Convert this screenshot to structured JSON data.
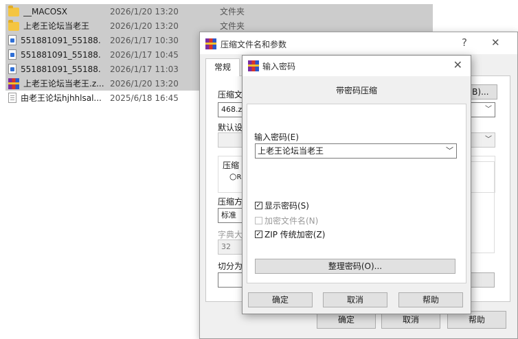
{
  "explorer": {
    "files": [
      {
        "name": "__MACOSX",
        "date": "2026/1/20 13:20",
        "type": "文件夹",
        "icon": "folder-icon",
        "selected": true
      },
      {
        "name": "上老王论坛当老王",
        "date": "2026/1/20 13:20",
        "type": "文件夹",
        "icon": "folder-icon",
        "selected": true
      },
      {
        "name": "551881091_55188...",
        "date": "2026/1/17 10:30",
        "type": "",
        "icon": "document-icon",
        "selected": true
      },
      {
        "name": "551881091_55188...",
        "date": "2026/1/17 10:45",
        "type": "",
        "icon": "document-icon",
        "selected": true
      },
      {
        "name": "551881091_55188...",
        "date": "2026/1/17 11:03",
        "type": "",
        "icon": "document-icon",
        "selected": true
      },
      {
        "name": "上老王论坛当老王.z...",
        "date": "2026/1/20 13:20",
        "type": "",
        "icon": "winrar-archive-icon",
        "selected": true
      },
      {
        "name": "由老王论坛hjhhlsal...",
        "date": "2025/6/18 16:45",
        "type": "",
        "icon": "text-file-icon",
        "selected": false
      }
    ]
  },
  "main_dialog": {
    "title": "压缩文件名和参数",
    "help_glyph": "?",
    "close_glyph": "✕",
    "tab_general": "常规",
    "archive_name_label": "压缩文",
    "browse_button": "(B)...",
    "archive_name_value": "468.zip",
    "default_profile_label": "默认设",
    "format_group_label": "压缩",
    "radio_partial": "R",
    "method_label": "压缩方",
    "method_value": "标准",
    "dict_label": "字典大",
    "dict_value": "32",
    "split_label": "切分为",
    "ok": "确定",
    "cancel": "取消",
    "help": "帮助"
  },
  "password_dialog": {
    "title": "输入密码",
    "close_glyph": "✕",
    "heading": "带密码压缩",
    "enter_label": "输入密码(E)",
    "password_value": "上老王论坛当老王",
    "show_password": {
      "label": "显示密码(S)",
      "checked": true,
      "enabled": true
    },
    "encrypt_names": {
      "label": "加密文件名(N)",
      "checked": false,
      "enabled": false
    },
    "zip_legacy": {
      "label": "ZIP 传统加密(Z)",
      "checked": true,
      "enabled": true
    },
    "organize_button": "整理密码(O)...",
    "ok": "确定",
    "cancel": "取消",
    "help": "帮助"
  }
}
